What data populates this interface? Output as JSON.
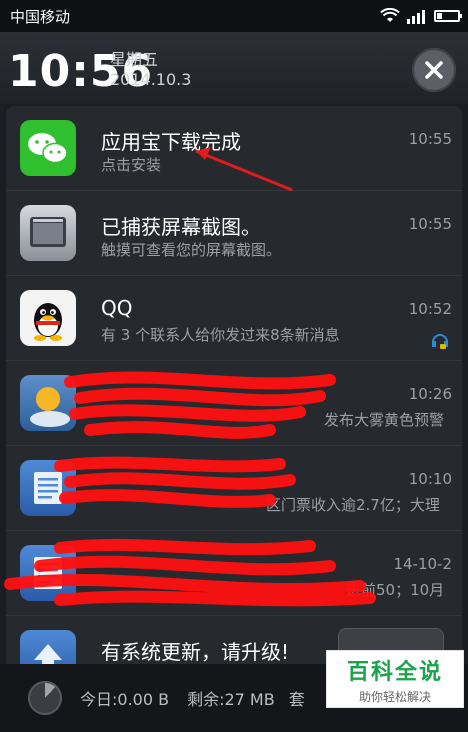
{
  "status_bar": {
    "carrier": "中国移动",
    "icons": [
      "wifi-icon",
      "signal-icon",
      "battery-icon"
    ]
  },
  "header": {
    "time": "10:56",
    "weekday": "星期五",
    "date": "2014.10.3",
    "close_icon": "close-icon"
  },
  "notifications": [
    {
      "icon": "wechat-icon",
      "title": "应用宝下载完成",
      "subtitle": "点击安装",
      "time": "10:55"
    },
    {
      "icon": "screenshot-icon",
      "title": "已捕获屏幕截图。",
      "subtitle": "触摸可查看您的屏幕截图。",
      "time": "10:55"
    },
    {
      "icon": "qq-icon",
      "title": "QQ",
      "subtitle": "有 3 个联系人给你发过来8条新消息",
      "time": "10:52"
    },
    {
      "icon": "weather-icon",
      "title": "",
      "subtitle": "发布大雾黄色预警",
      "time": "10:26"
    },
    {
      "icon": "news-icon",
      "title": "",
      "subtitle": "区门票收入逾2.7亿；大理",
      "time": "10:10"
    },
    {
      "icon": "news-icon",
      "title": "",
      "subtitle": "进前50；10月",
      "time": "14-10-2"
    },
    {
      "icon": "update-icon",
      "title": "有系统更新，请升级!",
      "subtitle": "",
      "time": ""
    }
  ],
  "bottom_bar": {
    "today": "今日:0.00 B",
    "left": "剩余:27 MB",
    "more": "套"
  },
  "watermark": {
    "title": "百科全说",
    "subtitle": "助你轻松解决"
  }
}
